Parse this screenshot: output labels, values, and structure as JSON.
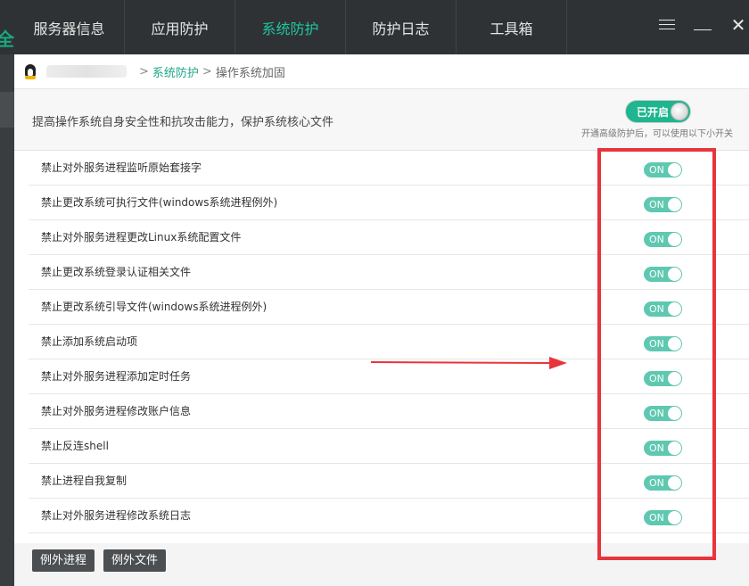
{
  "header": {
    "tabs": [
      {
        "label": "服务器信息",
        "active": false
      },
      {
        "label": "应用防护",
        "active": false
      },
      {
        "label": "系统防护",
        "active": true
      },
      {
        "label": "防护日志",
        "active": false
      },
      {
        "label": "工具箱",
        "active": false
      }
    ],
    "logo_glyph": "全",
    "close_glyph": "✕"
  },
  "breadcrumb": {
    "sep1": ">",
    "section": "系统防护",
    "sep2": ">",
    "current": "操作系统加固"
  },
  "description": {
    "text": "提高操作系统自身安全性和抗攻击能力，保护系统核心文件",
    "master_toggle_label": "已开启",
    "master_note": "开通高级防护后，可以使用以下小开关"
  },
  "rules": [
    {
      "label": "禁止对外服务进程监听原始套接字",
      "state": "ON"
    },
    {
      "label": "禁止更改系统可执行文件(windows系统进程例外)",
      "state": "ON"
    },
    {
      "label": "禁止对外服务进程更改Linux系统配置文件",
      "state": "ON"
    },
    {
      "label": "禁止更改系统登录认证相关文件",
      "state": "ON"
    },
    {
      "label": "禁止更改系统引导文件(windows系统进程例外)",
      "state": "ON"
    },
    {
      "label": "禁止添加系统启动项",
      "state": "ON"
    },
    {
      "label": "禁止对外服务进程添加定时任务",
      "state": "ON"
    },
    {
      "label": "禁止对外服务进程修改账户信息",
      "state": "ON"
    },
    {
      "label": "禁止反连shell",
      "state": "ON"
    },
    {
      "label": "禁止进程自我复制",
      "state": "ON"
    },
    {
      "label": "禁止对外服务进程修改系统日志",
      "state": "ON"
    }
  ],
  "buttons": {
    "exception_process": "例外进程",
    "exception_file": "例外文件"
  },
  "colors": {
    "accent": "#1fc6a0",
    "toggle_on": "#5ec8b0",
    "annotation_red": "#e8343c"
  }
}
